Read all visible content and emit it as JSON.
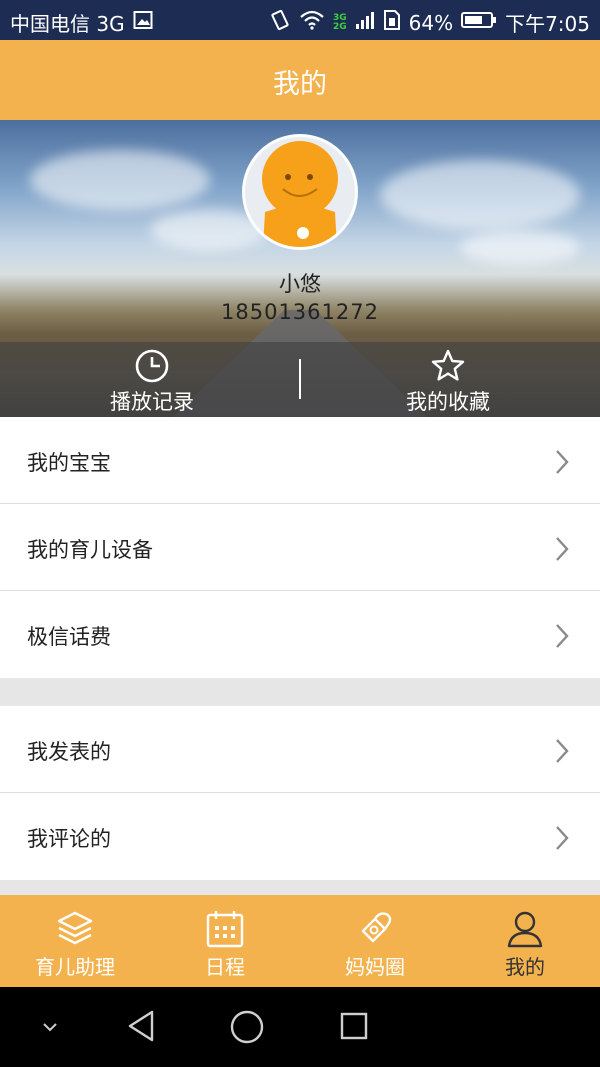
{
  "status_bar": {
    "carrier": "中国电信 3G",
    "network_tags": [
      "3G",
      "2G"
    ],
    "battery": "64%",
    "time": "下午7:05",
    "icons": [
      "image-icon",
      "vibrate-icon",
      "wifi-icon",
      "signal-icon",
      "sim-icon",
      "battery-icon"
    ]
  },
  "header": {
    "title": "我的"
  },
  "profile": {
    "name": "小悠",
    "phone": "18501361272",
    "actions": [
      {
        "label": "播放记录",
        "icon": "clock-icon"
      },
      {
        "label": "我的收藏",
        "icon": "star-icon"
      }
    ]
  },
  "menu_groups": [
    {
      "items": [
        {
          "label": "我的宝宝"
        },
        {
          "label": "我的育儿设备"
        },
        {
          "label": "极信话费"
        }
      ]
    },
    {
      "items": [
        {
          "label": "我发表的"
        },
        {
          "label": "我评论的"
        }
      ]
    }
  ],
  "tabs": [
    {
      "label": "育儿助理",
      "icon": "layers-icon",
      "active": false
    },
    {
      "label": "日程",
      "icon": "calendar-icon",
      "active": false
    },
    {
      "label": "妈妈圈",
      "icon": "pacifier-icon",
      "active": false
    },
    {
      "label": "我的",
      "icon": "person-icon",
      "active": true
    }
  ],
  "colors": {
    "accent": "#f4b24e",
    "status_bar": "#1d2c52",
    "active_tab_text": "#333333"
  },
  "nav_bar": [
    "chevron-down-icon",
    "back-icon",
    "home-icon",
    "recents-icon"
  ]
}
